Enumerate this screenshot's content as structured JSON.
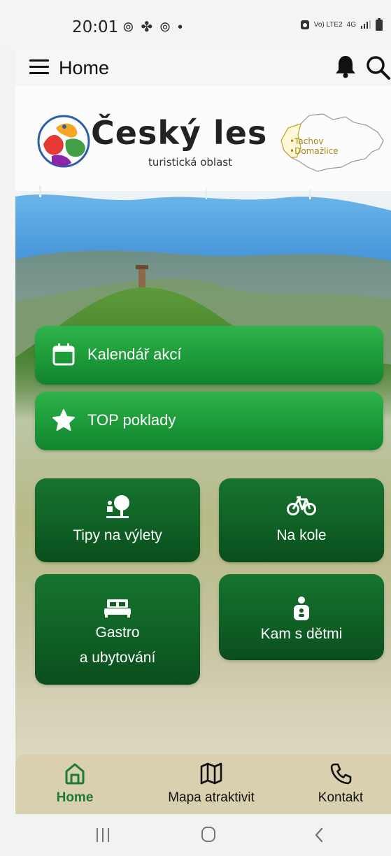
{
  "status_bar": {
    "time": "20:01",
    "notification_icons": "⊚ ✤ ⊚ •",
    "network": "Vo) LTE2",
    "signal_type": "4G"
  },
  "app_bar": {
    "title": "Home"
  },
  "header": {
    "brand_title": "Český les",
    "brand_subtitle": "turistická oblast",
    "region_label_1": "•Tachov",
    "region_label_2": "•Domažlice"
  },
  "menu": {
    "events_label": "Kalendář akcí",
    "top_label": "TOP poklady"
  },
  "tiles": [
    {
      "label": "Tipy na výlety"
    },
    {
      "label": "Na kole"
    },
    {
      "label_line1": "Gastro",
      "label_line2": "a ubytování"
    },
    {
      "label": "Kam s dětmi"
    }
  ],
  "bottom_nav": [
    {
      "label": "Home",
      "active": true
    },
    {
      "label": "Mapa atraktivit",
      "active": false
    },
    {
      "label": "Kontakt",
      "active": false
    }
  ],
  "colors": {
    "primary_green": "#1c9a39",
    "dark_green": "#0f5f25",
    "active_nav": "#1f7a35"
  }
}
